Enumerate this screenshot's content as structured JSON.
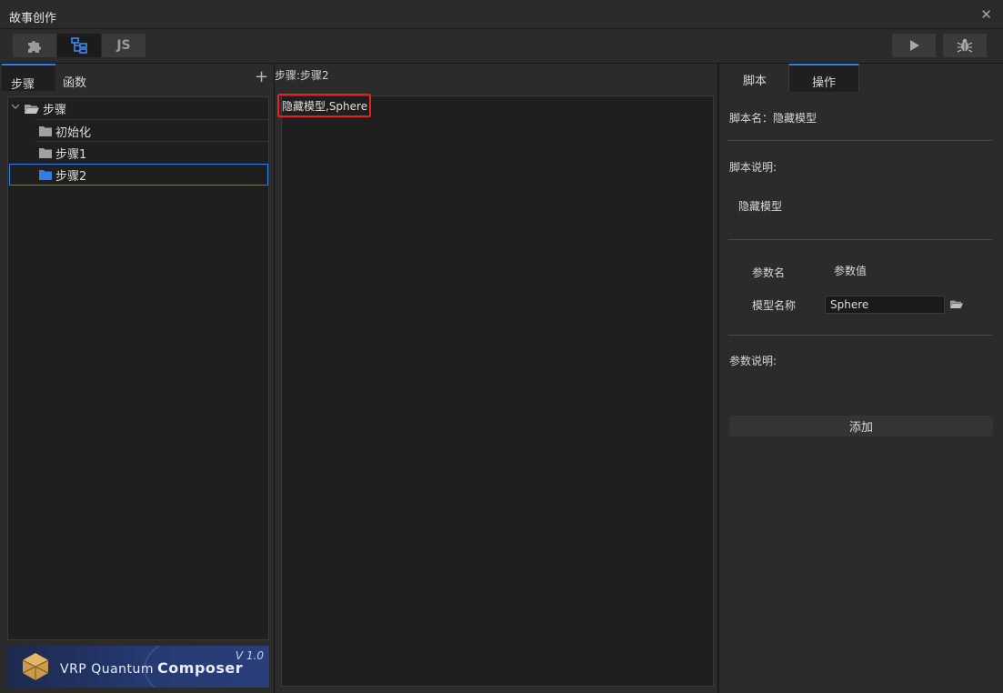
{
  "window": {
    "title": "故事创作",
    "close_glyph": "✕"
  },
  "toolbar": {
    "buttons": [
      {
        "icon": "puzzle-icon"
      },
      {
        "icon": "flowchart-icon"
      },
      {
        "label": "JS"
      }
    ],
    "run_icon": "play-icon",
    "debug_icon": "bug-icon"
  },
  "left_panel": {
    "tabs": [
      {
        "label": "步骤"
      },
      {
        "label": "函数"
      }
    ],
    "add_glyph": "+",
    "tree": {
      "root": {
        "label": "步骤"
      },
      "children": [
        {
          "label": "初始化"
        },
        {
          "label": "步骤1"
        },
        {
          "label": "步骤2"
        }
      ]
    },
    "banner": {
      "brand": "VRP Quantum",
      "product": "Composer",
      "version": "V 1.0"
    }
  },
  "middle_panel": {
    "breadcrumb": "步骤:步骤2",
    "script_line": "隐藏模型,Sphere"
  },
  "right_panel": {
    "tabs": [
      {
        "label": "脚本"
      },
      {
        "label": "操作"
      }
    ],
    "script_name_label": "脚本名：隐藏模型",
    "script_desc_label": "脚本说明:",
    "script_desc_value": "隐藏模型",
    "param_name_header": "参数名",
    "param_value_header": "参数值",
    "param_model_label": "模型名称",
    "param_model_value": "Sphere",
    "param_desc_label": "参数说明:",
    "add_button": "添加"
  },
  "colors": {
    "accent": "#2d7ee8",
    "highlight_box": "#e8201e",
    "folder": "#a0a0a0",
    "folder_selected": "#2d7ee8"
  }
}
